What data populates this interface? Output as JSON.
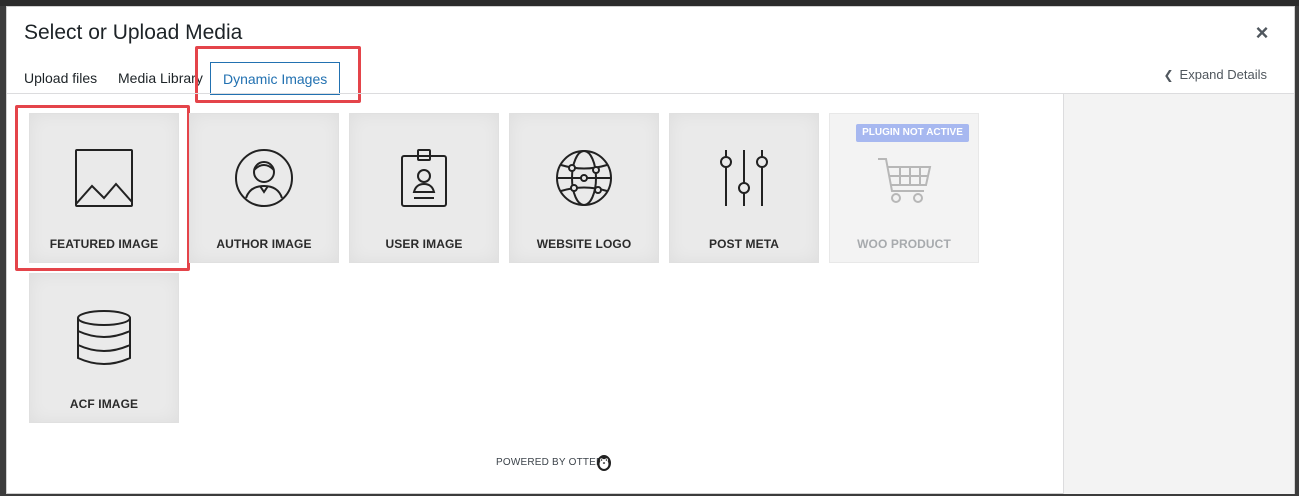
{
  "modal": {
    "title": "Select or Upload Media",
    "close_label": "×"
  },
  "tabs": [
    {
      "label": "Upload files"
    },
    {
      "label": "Media Library"
    },
    {
      "label": "Dynamic Images",
      "active": true
    }
  ],
  "expand_details": "Expand Details",
  "tiles": [
    {
      "label": "FEATURED IMAGE",
      "icon": "landscape-image-icon",
      "highlighted": true
    },
    {
      "label": "AUTHOR IMAGE",
      "icon": "user-circle-icon"
    },
    {
      "label": "USER IMAGE",
      "icon": "id-badge-icon"
    },
    {
      "label": "WEBSITE LOGO",
      "icon": "globe-network-icon"
    },
    {
      "label": "POST META",
      "icon": "sliders-icon"
    },
    {
      "label": "WOO PRODUCT",
      "icon": "shopping-cart-icon",
      "disabled": true,
      "badge": "PLUGIN NOT ACTIVE"
    },
    {
      "label": "ACF IMAGE",
      "icon": "database-icon"
    }
  ],
  "footer": {
    "powered_by": "POWERED BY OTTER",
    "logo_icon": "otter-logo-icon"
  },
  "colors": {
    "accent": "#2271b1",
    "highlight": "#e4444a",
    "badge": "#a7b8f0"
  }
}
